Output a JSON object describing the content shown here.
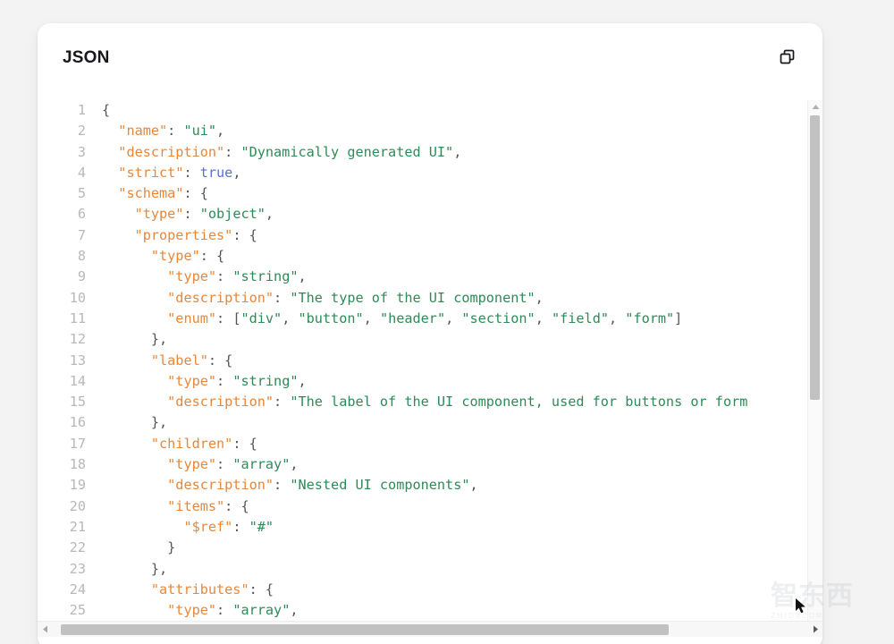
{
  "window": {
    "background_color": "#f3f3f3",
    "card_background": "#ffffff"
  },
  "panel": {
    "title": "JSON",
    "copy_button_label": "",
    "copy_icon": "copy-icon"
  },
  "colors": {
    "key": "#e8873a",
    "string": "#2e8b57",
    "boolean": "#5c6fd4",
    "punctuation": "#555555",
    "line_number": "#b8b8b8",
    "scrollbar_thumb": "#c1c1c1"
  },
  "code": {
    "language": "json",
    "first_visible_line": 1,
    "last_visible_line": 25,
    "lines": [
      {
        "n": "1",
        "tokens": [
          {
            "t": "p",
            "v": "{"
          }
        ]
      },
      {
        "n": "2",
        "tokens": [
          {
            "t": "p",
            "v": "  "
          },
          {
            "t": "k",
            "v": "\"name\""
          },
          {
            "t": "p",
            "v": ": "
          },
          {
            "t": "s",
            "v": "\"ui\""
          },
          {
            "t": "p",
            "v": ","
          }
        ]
      },
      {
        "n": "3",
        "tokens": [
          {
            "t": "p",
            "v": "  "
          },
          {
            "t": "k",
            "v": "\"description\""
          },
          {
            "t": "p",
            "v": ": "
          },
          {
            "t": "s",
            "v": "\"Dynamically generated UI\""
          },
          {
            "t": "p",
            "v": ","
          }
        ]
      },
      {
        "n": "4",
        "tokens": [
          {
            "t": "p",
            "v": "  "
          },
          {
            "t": "k",
            "v": "\"strict\""
          },
          {
            "t": "p",
            "v": ": "
          },
          {
            "t": "b",
            "v": "true"
          },
          {
            "t": "p",
            "v": ","
          }
        ]
      },
      {
        "n": "5",
        "tokens": [
          {
            "t": "p",
            "v": "  "
          },
          {
            "t": "k",
            "v": "\"schema\""
          },
          {
            "t": "p",
            "v": ": {"
          }
        ]
      },
      {
        "n": "6",
        "tokens": [
          {
            "t": "p",
            "v": "    "
          },
          {
            "t": "k",
            "v": "\"type\""
          },
          {
            "t": "p",
            "v": ": "
          },
          {
            "t": "s",
            "v": "\"object\""
          },
          {
            "t": "p",
            "v": ","
          }
        ]
      },
      {
        "n": "7",
        "tokens": [
          {
            "t": "p",
            "v": "    "
          },
          {
            "t": "k",
            "v": "\"properties\""
          },
          {
            "t": "p",
            "v": ": {"
          }
        ]
      },
      {
        "n": "8",
        "tokens": [
          {
            "t": "p",
            "v": "      "
          },
          {
            "t": "k",
            "v": "\"type\""
          },
          {
            "t": "p",
            "v": ": {"
          }
        ]
      },
      {
        "n": "9",
        "tokens": [
          {
            "t": "p",
            "v": "        "
          },
          {
            "t": "k",
            "v": "\"type\""
          },
          {
            "t": "p",
            "v": ": "
          },
          {
            "t": "s",
            "v": "\"string\""
          },
          {
            "t": "p",
            "v": ","
          }
        ]
      },
      {
        "n": "10",
        "tokens": [
          {
            "t": "p",
            "v": "        "
          },
          {
            "t": "k",
            "v": "\"description\""
          },
          {
            "t": "p",
            "v": ": "
          },
          {
            "t": "s",
            "v": "\"The type of the UI component\""
          },
          {
            "t": "p",
            "v": ","
          }
        ]
      },
      {
        "n": "11",
        "tokens": [
          {
            "t": "p",
            "v": "        "
          },
          {
            "t": "k",
            "v": "\"enum\""
          },
          {
            "t": "p",
            "v": ": ["
          },
          {
            "t": "s",
            "v": "\"div\""
          },
          {
            "t": "p",
            "v": ", "
          },
          {
            "t": "s",
            "v": "\"button\""
          },
          {
            "t": "p",
            "v": ", "
          },
          {
            "t": "s",
            "v": "\"header\""
          },
          {
            "t": "p",
            "v": ", "
          },
          {
            "t": "s",
            "v": "\"section\""
          },
          {
            "t": "p",
            "v": ", "
          },
          {
            "t": "s",
            "v": "\"field\""
          },
          {
            "t": "p",
            "v": ", "
          },
          {
            "t": "s",
            "v": "\"form\""
          },
          {
            "t": "p",
            "v": "]"
          }
        ]
      },
      {
        "n": "12",
        "tokens": [
          {
            "t": "p",
            "v": "      },"
          }
        ]
      },
      {
        "n": "13",
        "tokens": [
          {
            "t": "p",
            "v": "      "
          },
          {
            "t": "k",
            "v": "\"label\""
          },
          {
            "t": "p",
            "v": ": {"
          }
        ]
      },
      {
        "n": "14",
        "tokens": [
          {
            "t": "p",
            "v": "        "
          },
          {
            "t": "k",
            "v": "\"type\""
          },
          {
            "t": "p",
            "v": ": "
          },
          {
            "t": "s",
            "v": "\"string\""
          },
          {
            "t": "p",
            "v": ","
          }
        ]
      },
      {
        "n": "15",
        "tokens": [
          {
            "t": "p",
            "v": "        "
          },
          {
            "t": "k",
            "v": "\"description\""
          },
          {
            "t": "p",
            "v": ": "
          },
          {
            "t": "s",
            "v": "\"The label of the UI component, used for buttons or form"
          }
        ]
      },
      {
        "n": "16",
        "tokens": [
          {
            "t": "p",
            "v": "      },"
          }
        ]
      },
      {
        "n": "17",
        "tokens": [
          {
            "t": "p",
            "v": "      "
          },
          {
            "t": "k",
            "v": "\"children\""
          },
          {
            "t": "p",
            "v": ": {"
          }
        ]
      },
      {
        "n": "18",
        "tokens": [
          {
            "t": "p",
            "v": "        "
          },
          {
            "t": "k",
            "v": "\"type\""
          },
          {
            "t": "p",
            "v": ": "
          },
          {
            "t": "s",
            "v": "\"array\""
          },
          {
            "t": "p",
            "v": ","
          }
        ]
      },
      {
        "n": "19",
        "tokens": [
          {
            "t": "p",
            "v": "        "
          },
          {
            "t": "k",
            "v": "\"description\""
          },
          {
            "t": "p",
            "v": ": "
          },
          {
            "t": "s",
            "v": "\"Nested UI components\""
          },
          {
            "t": "p",
            "v": ","
          }
        ]
      },
      {
        "n": "20",
        "tokens": [
          {
            "t": "p",
            "v": "        "
          },
          {
            "t": "k",
            "v": "\"items\""
          },
          {
            "t": "p",
            "v": ": {"
          }
        ]
      },
      {
        "n": "21",
        "tokens": [
          {
            "t": "p",
            "v": "          "
          },
          {
            "t": "k",
            "v": "\"$ref\""
          },
          {
            "t": "p",
            "v": ": "
          },
          {
            "t": "s",
            "v": "\"#\""
          }
        ]
      },
      {
        "n": "22",
        "tokens": [
          {
            "t": "p",
            "v": "        }"
          }
        ]
      },
      {
        "n": "23",
        "tokens": [
          {
            "t": "p",
            "v": "      },"
          }
        ]
      },
      {
        "n": "24",
        "tokens": [
          {
            "t": "p",
            "v": "      "
          },
          {
            "t": "k",
            "v": "\"attributes\""
          },
          {
            "t": "p",
            "v": ": {"
          }
        ]
      },
      {
        "n": "25",
        "tokens": [
          {
            "t": "p",
            "v": "        "
          },
          {
            "t": "k",
            "v": "\"type\""
          },
          {
            "t": "p",
            "v": ": "
          },
          {
            "t": "s",
            "v": "\"array\""
          },
          {
            "t": "p",
            "v": ","
          }
        ]
      }
    ]
  },
  "scrollbars": {
    "vertical": {
      "arrow_up": "triangle-up-icon",
      "thumb_position": "top"
    },
    "horizontal": {
      "arrow_left": "triangle-left-icon",
      "arrow_right": "triangle-right-icon",
      "thumb_position": "left"
    }
  },
  "watermark": {
    "text": "智东西",
    "subtitle": "ZHIDXCOM"
  }
}
